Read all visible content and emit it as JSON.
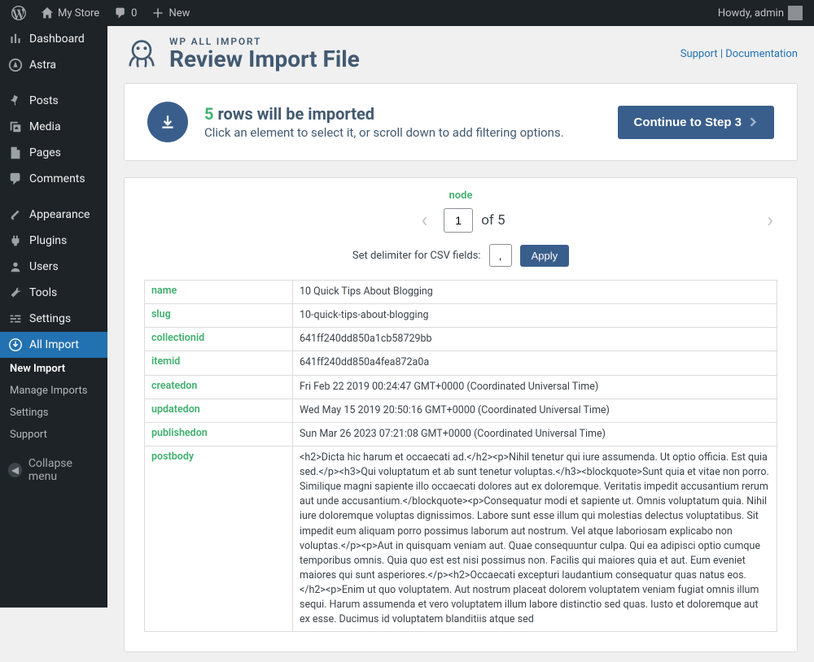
{
  "adminbar": {
    "site_name": "My Store",
    "comments": "0",
    "new_label": "New",
    "greeting": "Howdy, admin"
  },
  "sidebar": {
    "items": [
      {
        "label": "Dashboard"
      },
      {
        "label": "Astra"
      },
      {
        "label": "Posts"
      },
      {
        "label": "Media"
      },
      {
        "label": "Pages"
      },
      {
        "label": "Comments"
      },
      {
        "label": "Appearance"
      },
      {
        "label": "Plugins"
      },
      {
        "label": "Users"
      },
      {
        "label": "Tools"
      },
      {
        "label": "Settings"
      },
      {
        "label": "All Import"
      }
    ],
    "sub": [
      {
        "label": "New Import"
      },
      {
        "label": "Manage Imports"
      },
      {
        "label": "Settings"
      },
      {
        "label": "Support"
      }
    ],
    "collapse": "Collapse menu"
  },
  "header": {
    "brand": "WP ALL IMPORT",
    "title": "Review Import File",
    "support": "Support",
    "docs": "Documentation"
  },
  "banner": {
    "row_count": "5",
    "line1_suffix": " rows will be imported",
    "line2": "Click an element to select it, or scroll down to add filtering options.",
    "continue": "Continue to Step 3"
  },
  "pager": {
    "node_label": "node",
    "page_value": "1",
    "of_total": "of 5",
    "delimiter_label": "Set delimiter for CSV fields:",
    "delimiter_value": ",",
    "apply": "Apply"
  },
  "data_rows": [
    {
      "k": "name",
      "v": "10 Quick Tips About Blogging"
    },
    {
      "k": "slug",
      "v": "10-quick-tips-about-blogging"
    },
    {
      "k": "collectionid",
      "v": "641ff240dd850a1cb58729bb"
    },
    {
      "k": "itemid",
      "v": "641ff240dd850a4fea872a0a"
    },
    {
      "k": "createdon",
      "v": "Fri Feb 22 2019 00:24:47 GMT+0000 (Coordinated Universal Time)"
    },
    {
      "k": "updatedon",
      "v": "Wed May 15 2019 20:50:16 GMT+0000 (Coordinated Universal Time)"
    },
    {
      "k": "publishedon",
      "v": "Sun Mar 26 2023 07:21:08 GMT+0000 (Coordinated Universal Time)"
    },
    {
      "k": "postbody",
      "v": "<h2>Dicta hic harum et occaecati ad.</h2><p>Nihil tenetur qui iure assumenda. Ut optio officia. Est quia sed.</p><h3>Qui voluptatum et ab sunt tenetur voluptas.</h3><blockquote>Sunt quia et vitae non porro. Similique magni sapiente illo occaecati dolores aut ex doloremque. Veritatis impedit accusantium rerum aut unde accusantium.</blockquote><p>Consequatur modi et sapiente ut. Omnis voluptatum quia. Nihil iure doloremque voluptas dignissimos. Labore sunt esse illum qui molestias delectus voluptatibus. Sit impedit eum aliquam porro possimus laborum aut nostrum. Vel atque laboriosam explicabo non voluptas.</p><p>Aut in quisquam veniam aut. Quae consequuntur culpa. Qui ea adipisci optio cumque temporibus omnis. Quia quo est est nisi possimus non. Facilis qui maiores quia et aut. Eum eveniet maiores qui sunt asperiores.</p><h2>Occaecati excepturi laudantium consequatur quas natus eos.</h2><p>Enim ut quo voluptatem. Aut nostrum placeat dolorem voluptatem veniam fugiat omnis illum sequi. Harum assumenda et vero voluptatem illum labore distinctio sed quas. Iusto et doloremque aut ex esse. Ducimus id voluptatem blanditiis atque sed"
    }
  ]
}
